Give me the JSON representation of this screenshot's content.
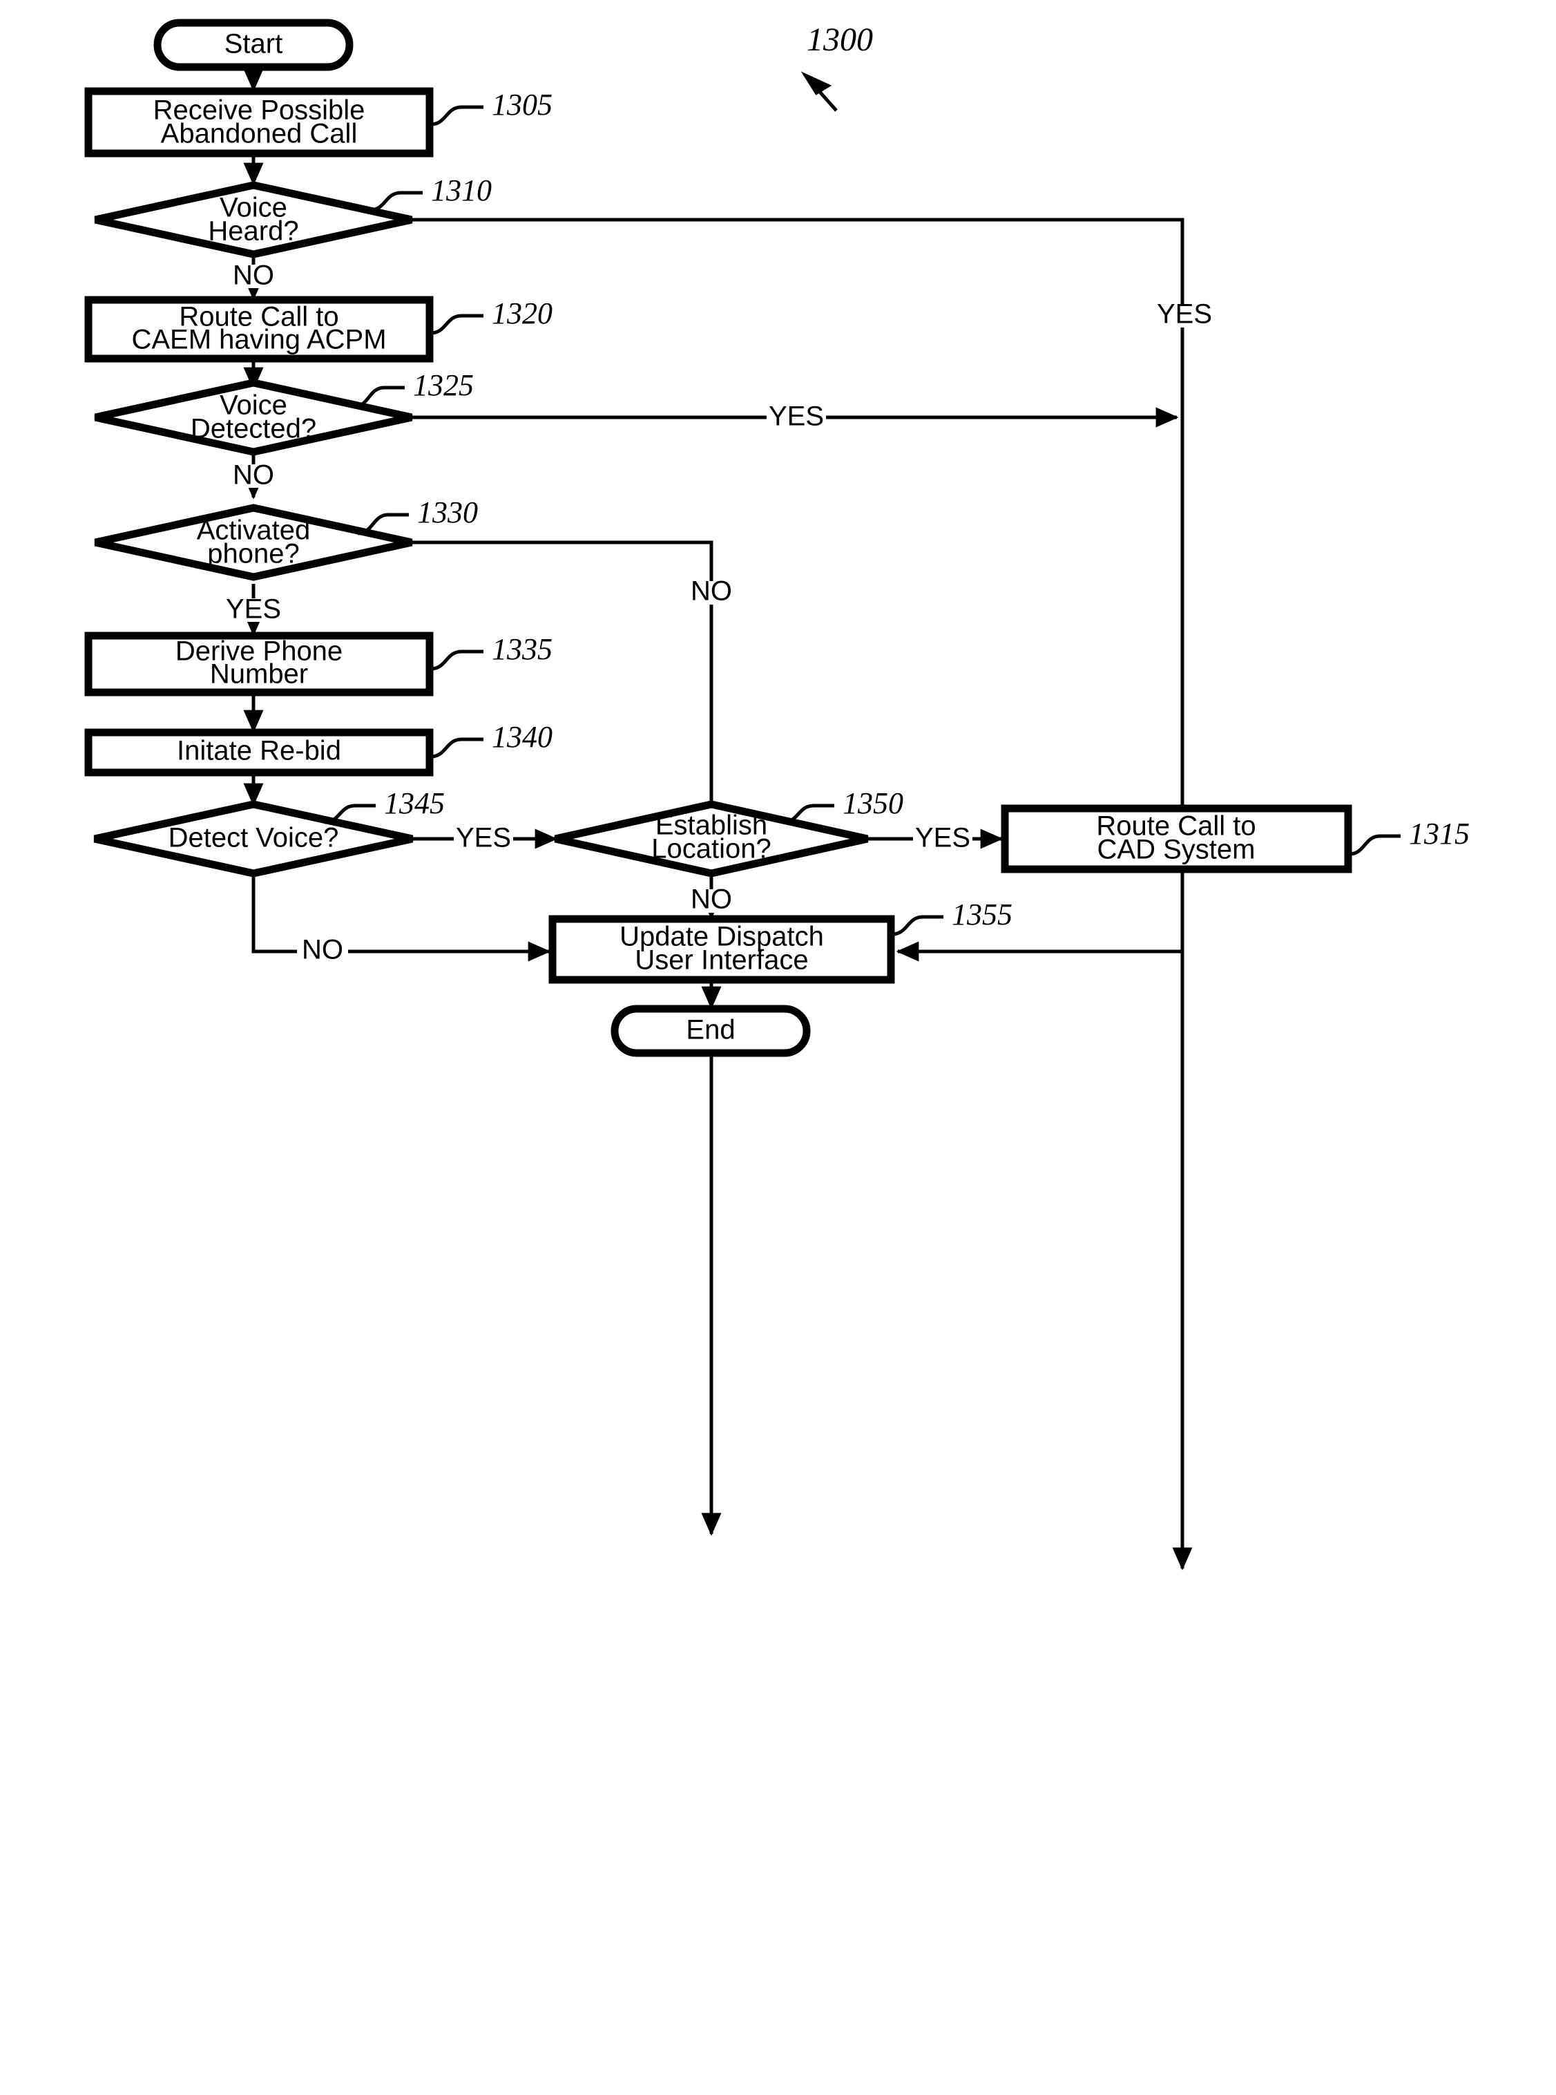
{
  "figure": {
    "number": "1300",
    "type": "flowchart",
    "title_ref": "1300"
  },
  "nodes": [
    {
      "id": "start",
      "kind": "terminator",
      "label": "Start",
      "lines": [
        "Start"
      ],
      "ref": null
    },
    {
      "id": "n1305",
      "kind": "process",
      "label": "Receive Possible Abandoned Call",
      "lines": [
        "Receive Possible",
        "Abandoned Call"
      ],
      "ref": "1305"
    },
    {
      "id": "n1310",
      "kind": "decision",
      "label": "Voice Heard?",
      "lines": [
        "Voice",
        "Heard?"
      ],
      "ref": "1310"
    },
    {
      "id": "n1320",
      "kind": "process",
      "label": "Route Call to CAEM having ACPM",
      "lines": [
        "Route Call to",
        "CAEM having ACPM"
      ],
      "ref": "1320"
    },
    {
      "id": "n1325",
      "kind": "decision",
      "label": "Voice Detected?",
      "lines": [
        "Voice",
        "Detected?"
      ],
      "ref": "1325"
    },
    {
      "id": "n1330",
      "kind": "decision",
      "label": "Activated phone?",
      "lines": [
        "Activated",
        "phone?"
      ],
      "ref": "1330"
    },
    {
      "id": "n1335",
      "kind": "process",
      "label": "Derive Phone Number",
      "lines": [
        "Derive Phone",
        "Number"
      ],
      "ref": "1335"
    },
    {
      "id": "n1340",
      "kind": "process",
      "label": "Initate Re-bid",
      "lines": [
        "Initate Re-bid"
      ],
      "ref": "1340"
    },
    {
      "id": "n1345",
      "kind": "decision",
      "label": "Detect Voice?",
      "lines": [
        "Detect Voice?"
      ],
      "ref": "1345"
    },
    {
      "id": "n1350",
      "kind": "decision",
      "label": "Establish Location?",
      "lines": [
        "Establish",
        "Location?"
      ],
      "ref": "1350"
    },
    {
      "id": "n1315",
      "kind": "process",
      "label": "Route Call to CAD System",
      "lines": [
        "Route Call to",
        "CAD System"
      ],
      "ref": "1315"
    },
    {
      "id": "n1355",
      "kind": "process",
      "label": "Update Dispatch User Interface",
      "lines": [
        "Update Dispatch",
        "User Interface"
      ],
      "ref": "1355"
    },
    {
      "id": "end",
      "kind": "terminator",
      "label": "End",
      "lines": [
        "End"
      ],
      "ref": null
    }
  ],
  "edges": [
    {
      "from": "start",
      "to": "n1305",
      "label": ""
    },
    {
      "from": "n1305",
      "to": "n1310",
      "label": ""
    },
    {
      "from": "n1310",
      "to": "n1315",
      "label": "YES"
    },
    {
      "from": "n1310",
      "to": "n1320",
      "label": "NO"
    },
    {
      "from": "n1320",
      "to": "n1325",
      "label": ""
    },
    {
      "from": "n1325",
      "to": "n1315",
      "label": "YES"
    },
    {
      "from": "n1325",
      "to": "n1330",
      "label": "NO"
    },
    {
      "from": "n1330",
      "to": "n1350",
      "label": "NO"
    },
    {
      "from": "n1330",
      "to": "n1335",
      "label": "YES"
    },
    {
      "from": "n1335",
      "to": "n1340",
      "label": ""
    },
    {
      "from": "n1340",
      "to": "n1345",
      "label": ""
    },
    {
      "from": "n1345",
      "to": "n1350",
      "label": "YES"
    },
    {
      "from": "n1345",
      "to": "n1355",
      "label": "NO"
    },
    {
      "from": "n1350",
      "to": "n1315",
      "label": "YES"
    },
    {
      "from": "n1350",
      "to": "n1355",
      "label": "NO"
    },
    {
      "from": "n1315",
      "to": "n1355",
      "label": ""
    },
    {
      "from": "n1355",
      "to": "end",
      "label": ""
    }
  ],
  "edge_labels": {
    "yes_1310": "YES",
    "no_1310": "NO",
    "yes_1325": "YES",
    "no_1325": "NO",
    "no_1330": "NO",
    "yes_1330": "YES",
    "yes_1345": "YES",
    "no_1345": "NO",
    "yes_1350": "YES",
    "no_1350": "NO"
  },
  "refs": {
    "fig": "1300",
    "r1305": "1305",
    "r1310": "1310",
    "r1315": "1315",
    "r1320": "1320",
    "r1325": "1325",
    "r1330": "1330",
    "r1335": "1335",
    "r1340": "1340",
    "r1345": "1345",
    "r1350": "1350",
    "r1355": "1355"
  },
  "colors": {
    "stroke": "#000000",
    "fill": "#ffffff"
  }
}
